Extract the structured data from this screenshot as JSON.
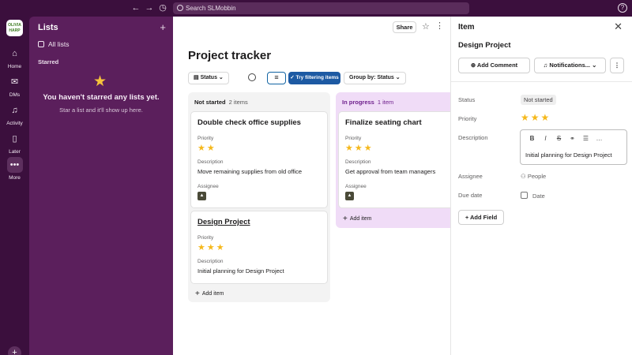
{
  "topbar": {
    "search_placeholder": "Search SLMobbin"
  },
  "workspace": {
    "initials": "OLIVIA HARP"
  },
  "rail": {
    "items": [
      {
        "label": "Home"
      },
      {
        "label": "DMs"
      },
      {
        "label": "Activity"
      },
      {
        "label": "Later"
      },
      {
        "label": "More"
      }
    ]
  },
  "sidebar": {
    "title": "Lists",
    "all_lists": "All lists",
    "starred_heading": "Starred",
    "empty_title": "You haven't starred any lists yet.",
    "empty_subtitle": "Star a list and it'll show up here."
  },
  "main": {
    "share_label": "Share",
    "title": "Project tracker",
    "filters": {
      "status": "Status",
      "try": "Try filtering items",
      "group_by": "Group by: Status"
    },
    "columns": [
      {
        "name": "Not started",
        "count": "2 items",
        "cards": [
          {
            "title": "Double check office supplies",
            "priority_label": "Priority",
            "stars": "★★",
            "desc_label": "Description",
            "desc": "Move remaining supplies from old office",
            "assignee_label": "Assignee"
          },
          {
            "title": "Design Project",
            "priority_label": "Priority",
            "stars": "★★★",
            "desc_label": "Description",
            "desc": "Initial planning for Design Project"
          }
        ],
        "add_item": "Add item"
      },
      {
        "name": "In progress",
        "count": "1 item",
        "cards": [
          {
            "title": "Finalize seating chart",
            "priority_label": "Priority",
            "stars": "★★★",
            "desc_label": "Description",
            "desc": "Get approval from team managers",
            "assignee_label": "Assignee"
          }
        ],
        "add_item": "Add item"
      }
    ]
  },
  "panel": {
    "title": "Item",
    "item_name": "Design Project",
    "add_comment": "Add Comment",
    "notifications": "Notifications...",
    "status_label": "Status",
    "status_value": "Not started",
    "priority_label": "Priority",
    "priority_stars": "★★★",
    "description_label": "Description",
    "description_value": "Initial planning for Design Project",
    "assignee_label": "Assignee",
    "assignee_placeholder": "People",
    "due_label": "Due date",
    "due_placeholder": "Date",
    "add_field": "Add Field"
  },
  "colors": {
    "accent": "#1d5aa3",
    "aubergine": "#3b0f3d",
    "star": "#f5b81c"
  }
}
